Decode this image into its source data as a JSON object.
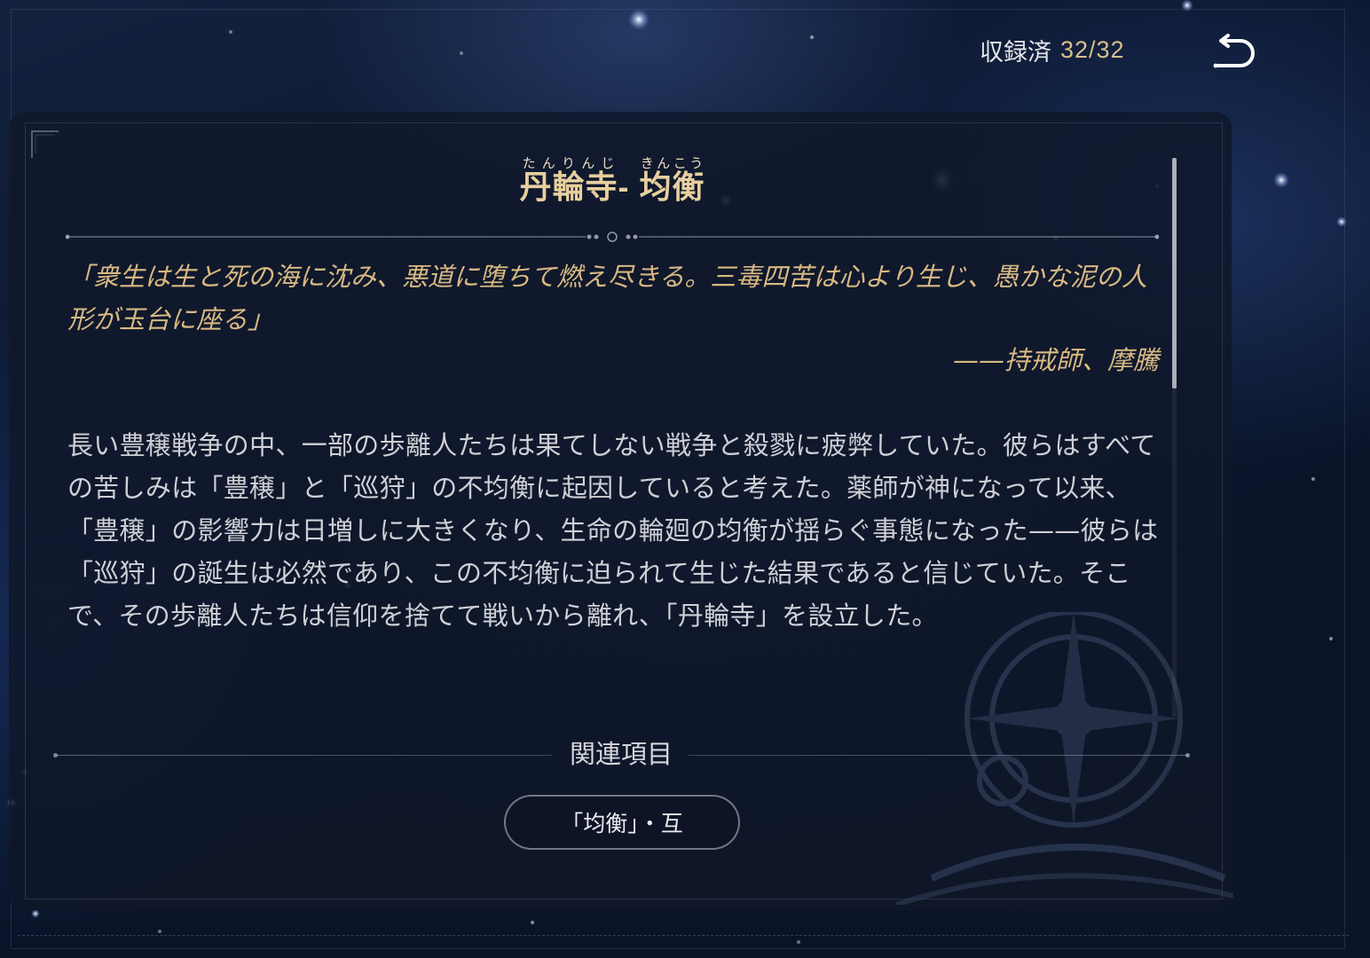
{
  "header": {
    "collected_label": "収録済",
    "collected_count": "32/32",
    "back_icon": "back-arrow-icon"
  },
  "entry": {
    "title_part1": "丹輪寺",
    "title_part1_ruby": "たんりんじ",
    "title_separator": "- ",
    "title_part2": "均衡",
    "title_part2_ruby": "きんこう",
    "quote": "「衆生は生と死の海に沈み、悪道に堕ちて燃え尽きる。三毒四苦は心より生じ、愚かな泥の人形が玉台に座る」",
    "quote_author": "——持戒師、摩騰",
    "body": "長い豊穣戦争の中、一部の歩離人たちは果てしない戦争と殺戮に疲弊していた。彼らはすべての苦しみは「豊穣」と「巡狩」の不均衡に起因していると考えた。薬師が神になって以来、「豊穣」の影響力は日増しに大きくなり、生命の輪廻の均衡が揺らぐ事態になった——彼らは「巡狩」の誕生は必然であり、この不均衡に迫られて生じた結果であると信じていた。そこで、その歩離人たちは信仰を捨てて戦いから離れ、「丹輪寺」を設立した。"
  },
  "related": {
    "heading": "関連項目",
    "items": [
      {
        "label": "「均衡」・互"
      }
    ]
  },
  "colors": {
    "accent_gold": "#d8b982",
    "title_gold": "#e7cf9e",
    "text": "#cfd0d6",
    "background": "#0b1426"
  }
}
